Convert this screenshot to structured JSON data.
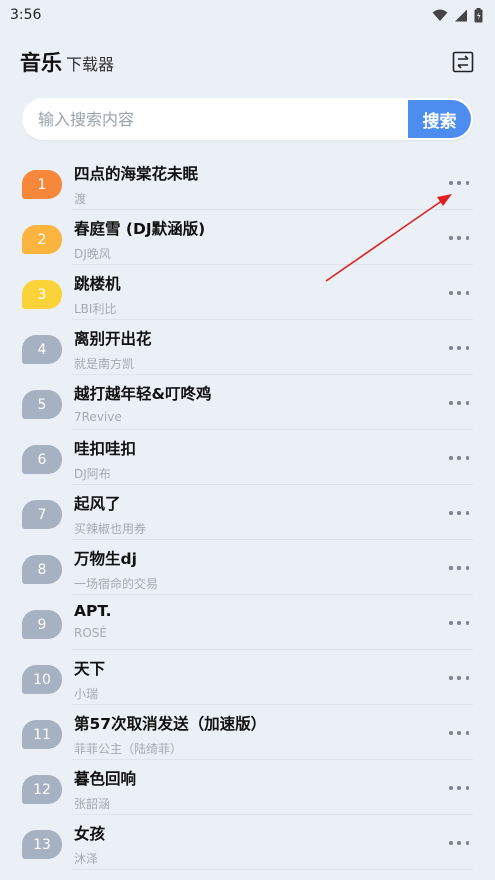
{
  "status": {
    "time": "3:56"
  },
  "header": {
    "title": "音乐",
    "subtitle": "下载器"
  },
  "search": {
    "placeholder": "输入搜索内容",
    "button_label": "搜索"
  },
  "colors": {
    "rank1": "#f7873a",
    "rank2": "#fbb53f",
    "rank3": "#fad23a",
    "rank_default": "#a6b1c1",
    "accent": "#4d8df0",
    "annotation": "#e02020"
  },
  "songs": [
    {
      "rank": "1",
      "title": "四点的海棠花未眠",
      "artist": "渡"
    },
    {
      "rank": "2",
      "title": "春庭雪 (DJ默涵版)",
      "artist": "DJ晚风"
    },
    {
      "rank": "3",
      "title": "跳楼机",
      "artist": "LBI利比"
    },
    {
      "rank": "4",
      "title": "离别开出花",
      "artist": "就是南方凯"
    },
    {
      "rank": "5",
      "title": "越打越年轻&叮咚鸡",
      "artist": "7Revive"
    },
    {
      "rank": "6",
      "title": "哇扣哇扣",
      "artist": "DJ阿布"
    },
    {
      "rank": "7",
      "title": "起风了",
      "artist": "买辣椒也用券"
    },
    {
      "rank": "8",
      "title": "万物生dj",
      "artist": "一场宿命的交易"
    },
    {
      "rank": "9",
      "title": "APT.",
      "artist": "ROSÉ"
    },
    {
      "rank": "10",
      "title": "天下",
      "artist": "小瑞"
    },
    {
      "rank": "11",
      "title": "第57次取消发送（加速版）",
      "artist": "菲菲公主（陆绮菲）"
    },
    {
      "rank": "12",
      "title": "暮色回响",
      "artist": "张韶涵"
    },
    {
      "rank": "13",
      "title": "女孩",
      "artist": "沐泽"
    }
  ]
}
